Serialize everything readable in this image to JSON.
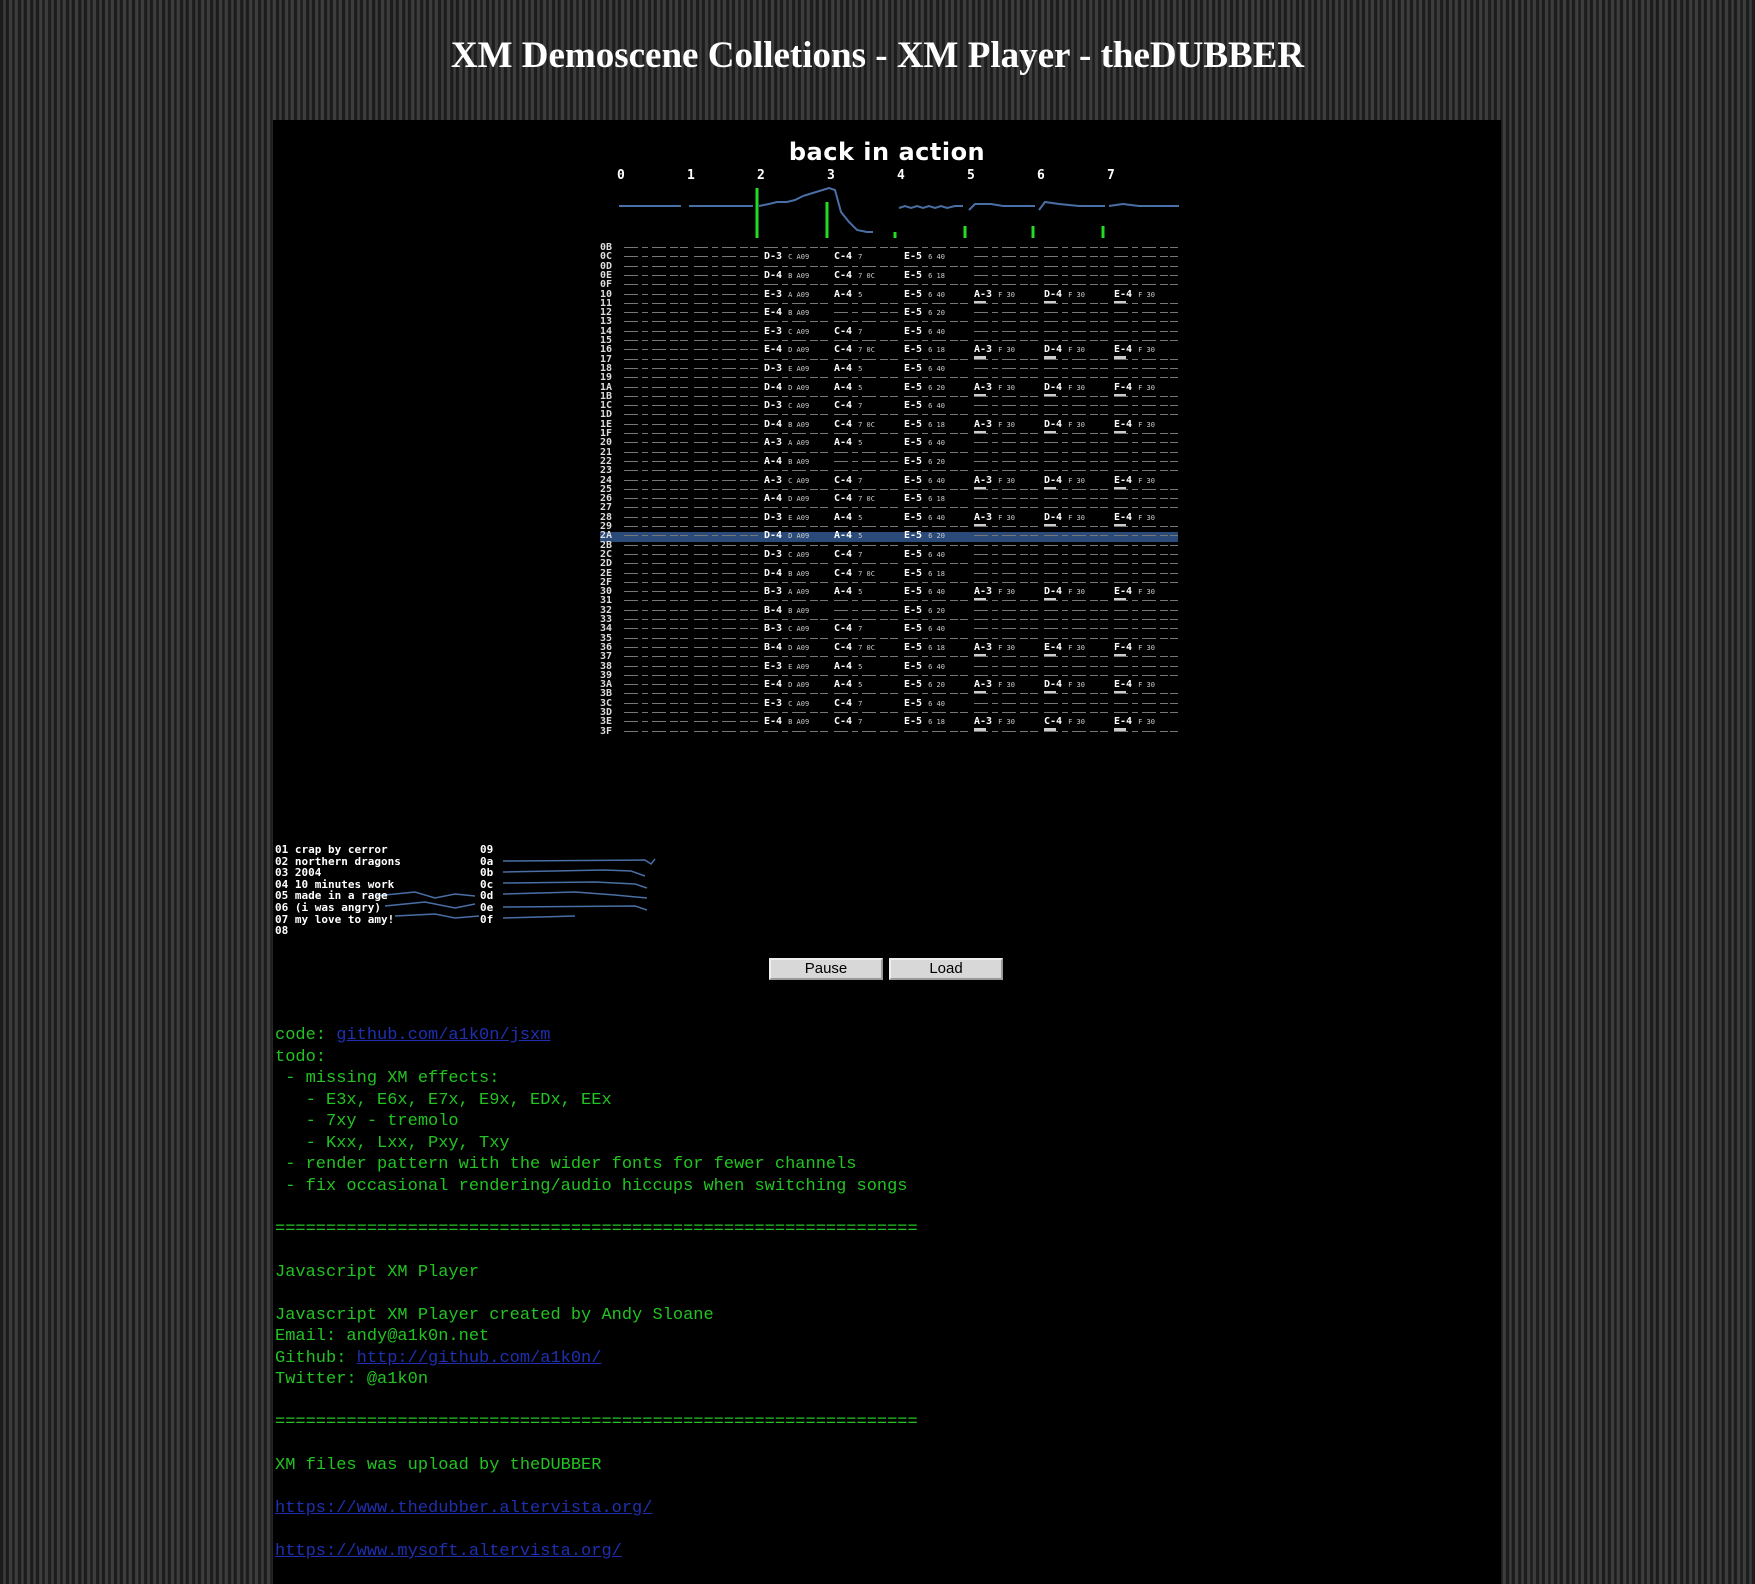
{
  "page_title": "XM Demoscene Colletions - XM Player - theDUBBER",
  "song_title": "back in action",
  "channels": [
    "0",
    "1",
    "2",
    "3",
    "4",
    "5",
    "6",
    "7"
  ],
  "pattern": {
    "row_numbers": [
      "0B",
      "0C",
      "0D",
      "0E",
      "0F",
      "10",
      "11",
      "12",
      "13",
      "14",
      "15",
      "16",
      "17",
      "18",
      "19",
      "1A",
      "1B",
      "1C",
      "1D",
      "1E",
      "1F",
      "20",
      "21",
      "22",
      "23",
      "24",
      "25",
      "26",
      "27",
      "28",
      "29",
      "2A",
      "2B",
      "2C",
      "2D",
      "2E",
      "2F",
      "30",
      "31",
      "32",
      "33",
      "34",
      "35",
      "36",
      "37",
      "38",
      "39",
      "3A",
      "3B",
      "3C",
      "3D",
      "3E",
      "3F"
    ],
    "highlight_row": "2A",
    "notes": [
      {
        "row": "0C",
        "ch": 2,
        "note": "D-3",
        "ins": "C",
        "fx": "A09"
      },
      {
        "row": "0C",
        "ch": 3,
        "note": "C-4",
        "ins": "7"
      },
      {
        "row": "0C",
        "ch": 4,
        "note": "E-5",
        "ins": "6",
        "fx": "40"
      },
      {
        "row": "0E",
        "ch": 2,
        "note": "D-4",
        "ins": "B",
        "fx": "A09"
      },
      {
        "row": "0E",
        "ch": 3,
        "note": "C-4",
        "ins": "7",
        "fx": "0C"
      },
      {
        "row": "0E",
        "ch": 4,
        "note": "E-5",
        "ins": "6",
        "fx": "18"
      },
      {
        "row": "10",
        "ch": 2,
        "note": "E-3",
        "ins": "A",
        "fx": "A09"
      },
      {
        "row": "10",
        "ch": 3,
        "note": "A-4",
        "ins": "5"
      },
      {
        "row": "10",
        "ch": 4,
        "note": "E-5",
        "ins": "6",
        "fx": "40"
      },
      {
        "row": "10",
        "ch": 5,
        "note": "A-3",
        "ins": "F",
        "fx": "30"
      },
      {
        "row": "10",
        "ch": 6,
        "note": "D-4",
        "ins": "F",
        "fx": "30"
      },
      {
        "row": "10",
        "ch": 7,
        "note": "E-4",
        "ins": "F",
        "fx": "30"
      },
      {
        "row": "12",
        "ch": 2,
        "note": "E-4",
        "ins": "B",
        "fx": "A09"
      },
      {
        "row": "12",
        "ch": 4,
        "note": "E-5",
        "ins": "6",
        "fx": "20"
      },
      {
        "row": "14",
        "ch": 2,
        "note": "E-3",
        "ins": "C",
        "fx": "A09"
      },
      {
        "row": "14",
        "ch": 3,
        "note": "C-4",
        "ins": "7"
      },
      {
        "row": "14",
        "ch": 4,
        "note": "E-5",
        "ins": "6",
        "fx": "40"
      },
      {
        "row": "16",
        "ch": 2,
        "note": "E-4",
        "ins": "D",
        "fx": "A09"
      },
      {
        "row": "16",
        "ch": 3,
        "note": "C-4",
        "ins": "7",
        "fx": "0C"
      },
      {
        "row": "16",
        "ch": 4,
        "note": "E-5",
        "ins": "6",
        "fx": "18"
      },
      {
        "row": "16",
        "ch": 5,
        "note": "A-3",
        "ins": "F",
        "fx": "30"
      },
      {
        "row": "16",
        "ch": 6,
        "note": "D-4",
        "ins": "F",
        "fx": "30"
      },
      {
        "row": "16",
        "ch": 7,
        "note": "E-4",
        "ins": "F",
        "fx": "30"
      },
      {
        "row": "18",
        "ch": 2,
        "note": "D-3",
        "ins": "E",
        "fx": "A09"
      },
      {
        "row": "18",
        "ch": 3,
        "note": "A-4",
        "ins": "5"
      },
      {
        "row": "18",
        "ch": 4,
        "note": "E-5",
        "ins": "6",
        "fx": "40"
      },
      {
        "row": "1A",
        "ch": 2,
        "note": "D-4",
        "ins": "D",
        "fx": "A09"
      },
      {
        "row": "1A",
        "ch": 3,
        "note": "A-4",
        "ins": "5"
      },
      {
        "row": "1A",
        "ch": 4,
        "note": "E-5",
        "ins": "6",
        "fx": "20"
      },
      {
        "row": "1A",
        "ch": 5,
        "note": "A-3",
        "ins": "F",
        "fx": "30"
      },
      {
        "row": "1A",
        "ch": 6,
        "note": "D-4",
        "ins": "F",
        "fx": "30"
      },
      {
        "row": "1A",
        "ch": 7,
        "note": "F-4",
        "ins": "F",
        "fx": "30"
      },
      {
        "row": "1C",
        "ch": 2,
        "note": "D-3",
        "ins": "C",
        "fx": "A09"
      },
      {
        "row": "1C",
        "ch": 3,
        "note": "C-4",
        "ins": "7"
      },
      {
        "row": "1C",
        "ch": 4,
        "note": "E-5",
        "ins": "6",
        "fx": "40"
      },
      {
        "row": "1E",
        "ch": 2,
        "note": "D-4",
        "ins": "B",
        "fx": "A09"
      },
      {
        "row": "1E",
        "ch": 3,
        "note": "C-4",
        "ins": "7",
        "fx": "0C"
      },
      {
        "row": "1E",
        "ch": 4,
        "note": "E-5",
        "ins": "6",
        "fx": "18"
      },
      {
        "row": "1E",
        "ch": 5,
        "note": "A-3",
        "ins": "F",
        "fx": "30"
      },
      {
        "row": "1E",
        "ch": 6,
        "note": "D-4",
        "ins": "F",
        "fx": "30"
      },
      {
        "row": "1E",
        "ch": 7,
        "note": "E-4",
        "ins": "F",
        "fx": "30"
      },
      {
        "row": "20",
        "ch": 2,
        "note": "A-3",
        "ins": "A",
        "fx": "A09"
      },
      {
        "row": "20",
        "ch": 3,
        "note": "A-4",
        "ins": "5"
      },
      {
        "row": "20",
        "ch": 4,
        "note": "E-5",
        "ins": "6",
        "fx": "40"
      },
      {
        "row": "22",
        "ch": 2,
        "note": "A-4",
        "ins": "B",
        "fx": "A09"
      },
      {
        "row": "22",
        "ch": 4,
        "note": "E-5",
        "ins": "6",
        "fx": "20"
      },
      {
        "row": "24",
        "ch": 2,
        "note": "A-3",
        "ins": "C",
        "fx": "A09"
      },
      {
        "row": "24",
        "ch": 3,
        "note": "C-4",
        "ins": "7"
      },
      {
        "row": "24",
        "ch": 4,
        "note": "E-5",
        "ins": "6",
        "fx": "40"
      },
      {
        "row": "24",
        "ch": 5,
        "note": "A-3",
        "ins": "F",
        "fx": "30"
      },
      {
        "row": "24",
        "ch": 6,
        "note": "D-4",
        "ins": "F",
        "fx": "30"
      },
      {
        "row": "24",
        "ch": 7,
        "note": "E-4",
        "ins": "F",
        "fx": "30"
      },
      {
        "row": "26",
        "ch": 2,
        "note": "A-4",
        "ins": "D",
        "fx": "A09"
      },
      {
        "row": "26",
        "ch": 3,
        "note": "C-4",
        "ins": "7",
        "fx": "0C"
      },
      {
        "row": "26",
        "ch": 4,
        "note": "E-5",
        "ins": "6",
        "fx": "18"
      },
      {
        "row": "28",
        "ch": 2,
        "note": "D-3",
        "ins": "E",
        "fx": "A09"
      },
      {
        "row": "28",
        "ch": 3,
        "note": "A-4",
        "ins": "5"
      },
      {
        "row": "28",
        "ch": 4,
        "note": "E-5",
        "ins": "6",
        "fx": "40"
      },
      {
        "row": "28",
        "ch": 5,
        "note": "A-3",
        "ins": "F",
        "fx": "30"
      },
      {
        "row": "28",
        "ch": 6,
        "note": "D-4",
        "ins": "F",
        "fx": "30"
      },
      {
        "row": "28",
        "ch": 7,
        "note": "E-4",
        "ins": "F",
        "fx": "30"
      },
      {
        "row": "2A",
        "ch": 2,
        "note": "D-4",
        "ins": "D",
        "fx": "A09"
      },
      {
        "row": "2A",
        "ch": 3,
        "note": "A-4",
        "ins": "5"
      },
      {
        "row": "2A",
        "ch": 4,
        "note": "E-5",
        "ins": "6",
        "fx": "20"
      },
      {
        "row": "2C",
        "ch": 2,
        "note": "D-3",
        "ins": "C",
        "fx": "A09"
      },
      {
        "row": "2C",
        "ch": 3,
        "note": "C-4",
        "ins": "7"
      },
      {
        "row": "2C",
        "ch": 4,
        "note": "E-5",
        "ins": "6",
        "fx": "40"
      },
      {
        "row": "2E",
        "ch": 2,
        "note": "D-4",
        "ins": "B",
        "fx": "A09"
      },
      {
        "row": "2E",
        "ch": 3,
        "note": "C-4",
        "ins": "7",
        "fx": "0C"
      },
      {
        "row": "2E",
        "ch": 4,
        "note": "E-5",
        "ins": "6",
        "fx": "18"
      },
      {
        "row": "30",
        "ch": 2,
        "note": "B-3",
        "ins": "A",
        "fx": "A09"
      },
      {
        "row": "30",
        "ch": 3,
        "note": "A-4",
        "ins": "5"
      },
      {
        "row": "30",
        "ch": 4,
        "note": "E-5",
        "ins": "6",
        "fx": "40"
      },
      {
        "row": "30",
        "ch": 5,
        "note": "A-3",
        "ins": "F",
        "fx": "30"
      },
      {
        "row": "30",
        "ch": 6,
        "note": "D-4",
        "ins": "F",
        "fx": "30"
      },
      {
        "row": "30",
        "ch": 7,
        "note": "E-4",
        "ins": "F",
        "fx": "30"
      },
      {
        "row": "32",
        "ch": 2,
        "note": "B-4",
        "ins": "B",
        "fx": "A09"
      },
      {
        "row": "32",
        "ch": 4,
        "note": "E-5",
        "ins": "6",
        "fx": "20"
      },
      {
        "row": "34",
        "ch": 2,
        "note": "B-3",
        "ins": "C",
        "fx": "A09"
      },
      {
        "row": "34",
        "ch": 3,
        "note": "C-4",
        "ins": "7"
      },
      {
        "row": "34",
        "ch": 4,
        "note": "E-5",
        "ins": "6",
        "fx": "40"
      },
      {
        "row": "36",
        "ch": 2,
        "note": "B-4",
        "ins": "D",
        "fx": "A09"
      },
      {
        "row": "36",
        "ch": 3,
        "note": "C-4",
        "ins": "7",
        "fx": "0C"
      },
      {
        "row": "36",
        "ch": 4,
        "note": "E-5",
        "ins": "6",
        "fx": "18"
      },
      {
        "row": "36",
        "ch": 5,
        "note": "A-3",
        "ins": "F",
        "fx": "30"
      },
      {
        "row": "36",
        "ch": 6,
        "note": "E-4",
        "ins": "F",
        "fx": "30"
      },
      {
        "row": "36",
        "ch": 7,
        "note": "F-4",
        "ins": "F",
        "fx": "30"
      },
      {
        "row": "38",
        "ch": 2,
        "note": "E-3",
        "ins": "E",
        "fx": "A09"
      },
      {
        "row": "38",
        "ch": 3,
        "note": "A-4",
        "ins": "5"
      },
      {
        "row": "38",
        "ch": 4,
        "note": "E-5",
        "ins": "6",
        "fx": "40"
      },
      {
        "row": "3A",
        "ch": 2,
        "note": "E-4",
        "ins": "D",
        "fx": "A09"
      },
      {
        "row": "3A",
        "ch": 3,
        "note": "A-4",
        "ins": "5"
      },
      {
        "row": "3A",
        "ch": 4,
        "note": "E-5",
        "ins": "6",
        "fx": "20"
      },
      {
        "row": "3A",
        "ch": 5,
        "note": "A-3",
        "ins": "F",
        "fx": "30"
      },
      {
        "row": "3A",
        "ch": 6,
        "note": "D-4",
        "ins": "F",
        "fx": "30"
      },
      {
        "row": "3A",
        "ch": 7,
        "note": "E-4",
        "ins": "F",
        "fx": "30"
      },
      {
        "row": "3C",
        "ch": 2,
        "note": "E-3",
        "ins": "C",
        "fx": "A09"
      },
      {
        "row": "3C",
        "ch": 3,
        "note": "C-4",
        "ins": "7"
      },
      {
        "row": "3C",
        "ch": 4,
        "note": "E-5",
        "ins": "6",
        "fx": "40"
      },
      {
        "row": "3E",
        "ch": 2,
        "note": "E-4",
        "ins": "B",
        "fx": "A09"
      },
      {
        "row": "3E",
        "ch": 3,
        "note": "C-4",
        "ins": "7"
      },
      {
        "row": "3E",
        "ch": 4,
        "note": "E-5",
        "ins": "6",
        "fx": "18"
      },
      {
        "row": "3E",
        "ch": 5,
        "note": "A-3",
        "ins": "F",
        "fx": "30"
      },
      {
        "row": "3E",
        "ch": 6,
        "note": "C-4",
        "ins": "F",
        "fx": "30"
      },
      {
        "row": "3E",
        "ch": 7,
        "note": "E-4",
        "ins": "F",
        "fx": "30"
      }
    ]
  },
  "instruments_left": [
    "01 crap by cerror",
    "02 northern dragons",
    "03 2004",
    "04 10 minutes work",
    "05 made in a rage",
    "06 (i was angry)",
    "07 my love to amy!",
    "08"
  ],
  "instruments_right": [
    "09",
    "0a",
    "0b",
    "0c",
    "0d",
    "0e",
    "0f"
  ],
  "buttons": {
    "pause": "Pause",
    "load": "Load"
  },
  "info": {
    "code_label": "code: ",
    "code_link": "github.com/a1k0n/jsxm",
    "todo_lines": [
      "todo:",
      " - missing XM effects:",
      "   - E3x, E6x, E7x, E9x, EDx, EEx",
      "   - 7xy - tremolo",
      "   - Kxx, Lxx, Pxy, Txy",
      " - render pattern with the wider fonts for fewer channels",
      " - fix occasional rendering/audio hiccups when switching songs"
    ],
    "separator": "===============================================================",
    "player_title": "Javascript XM Player",
    "created_by": "Javascript XM Player created by Andy Sloane",
    "email": "Email: andy@a1k0n.net",
    "github_label": "Github: ",
    "github_link": "http://github.com/a1k0n/",
    "twitter": "Twitter: @a1k0n",
    "upload_line": "XM files was upload by theDUBBER",
    "link1": "https://www.thedubber.altervista.org/",
    "link2": "https://www.mysoft.altervista.org/",
    "separator_short": "====================================="
  },
  "colors": {
    "text_green": "#22c322",
    "link_blue": "#1f2fb0",
    "scope_blue": "#4a6fa5",
    "scope_green": "#22dd22",
    "highlight": "#2a4a7a"
  }
}
